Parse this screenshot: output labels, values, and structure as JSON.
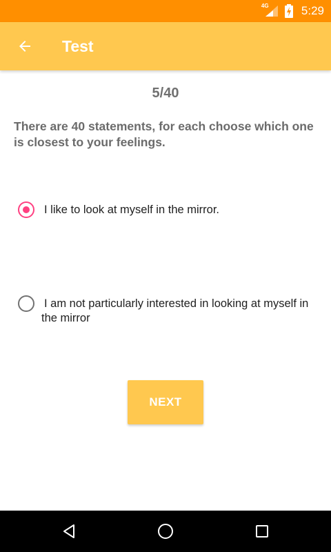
{
  "status_bar": {
    "network_label": "4G",
    "time": "5:29",
    "icons": [
      "signal-icon",
      "battery-charging-icon"
    ]
  },
  "app_bar": {
    "title": "Test",
    "back_icon": "arrow-left-icon"
  },
  "test": {
    "progress": "5/40",
    "instructions": "There are 40 statements, for each choose which one is closest to your feelings.",
    "options": [
      {
        "label": "I like to look at myself in the mirror.",
        "selected": true
      },
      {
        "label": "I am not particularly interested in looking at myself in the mirror",
        "selected": false
      }
    ],
    "next_label": "NEXT"
  },
  "nav_bar": {
    "icons": [
      "back-triangle-icon",
      "home-circle-icon",
      "recents-square-icon"
    ]
  },
  "colors": {
    "status_bar": "#ff8f00",
    "app_bar": "#ffc84f",
    "accent": "#ff4081",
    "button": "#ffc84f"
  }
}
